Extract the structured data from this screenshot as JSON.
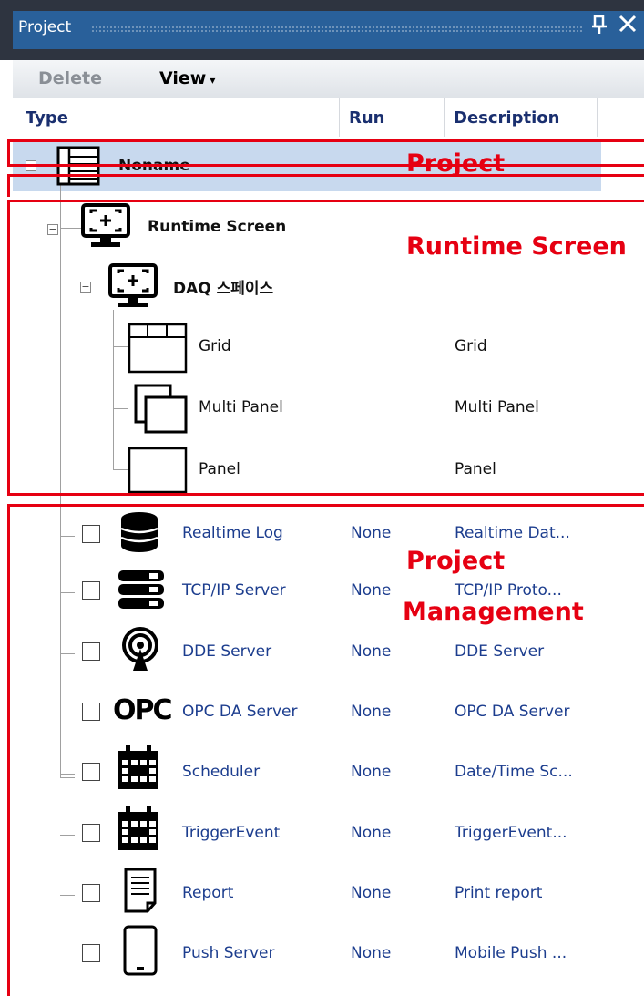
{
  "panel": {
    "title": "Project",
    "pin_glyph": "Ԅ",
    "close_glyph": "×"
  },
  "toolbar": {
    "delete_label": "Delete",
    "view_label": "View",
    "view_caret": "▾"
  },
  "columns": {
    "type": "Type",
    "run": "Run",
    "description": "Description"
  },
  "tree": {
    "root": {
      "label": "Noname",
      "icon": "project-list-icon"
    },
    "runtime_screen": {
      "label": "Runtime Screen",
      "icon": "screen-icon"
    },
    "daq_space": {
      "label": "DAQ 스페이스",
      "icon": "screen-icon"
    },
    "screen_items": [
      {
        "label": "Grid",
        "description": "Grid",
        "icon": "grid-icon"
      },
      {
        "label": "Multi Panel",
        "description": "Multi Panel",
        "icon": "multi-panel-icon"
      },
      {
        "label": "Panel",
        "description": "Panel",
        "icon": "panel-icon"
      }
    ],
    "management_items": [
      {
        "label": "Realtime Log",
        "run": "None",
        "description": "Realtime Dat...",
        "icon": "database-icon"
      },
      {
        "label": "TCP/IP Server",
        "run": "None",
        "description": "TCP/IP Proto...",
        "icon": "server-icon"
      },
      {
        "label": "DDE Server",
        "run": "None",
        "description": "DDE Server",
        "icon": "broadcast-icon"
      },
      {
        "label": "OPC DA Server",
        "run": "None",
        "description": "OPC DA Server",
        "icon": "opc-logo-icon"
      },
      {
        "label": "Scheduler",
        "run": "None",
        "description": "Date/Time Sc...",
        "icon": "calendar-icon"
      },
      {
        "label": "TriggerEvent",
        "run": "None",
        "description": "TriggerEvent...",
        "icon": "calendar-icon"
      },
      {
        "label": "Report",
        "run": "None",
        "description": "Print report",
        "icon": "document-icon"
      },
      {
        "label": "Push Server",
        "run": "None",
        "description": "Mobile Push ...",
        "icon": "tablet-icon"
      }
    ]
  },
  "annotations": {
    "project": "Project",
    "runtime_screen": "Runtime Screen",
    "management_line1": "Project",
    "management_line2": "Management",
    "color": "#e60012"
  },
  "opc_text": "OPC"
}
